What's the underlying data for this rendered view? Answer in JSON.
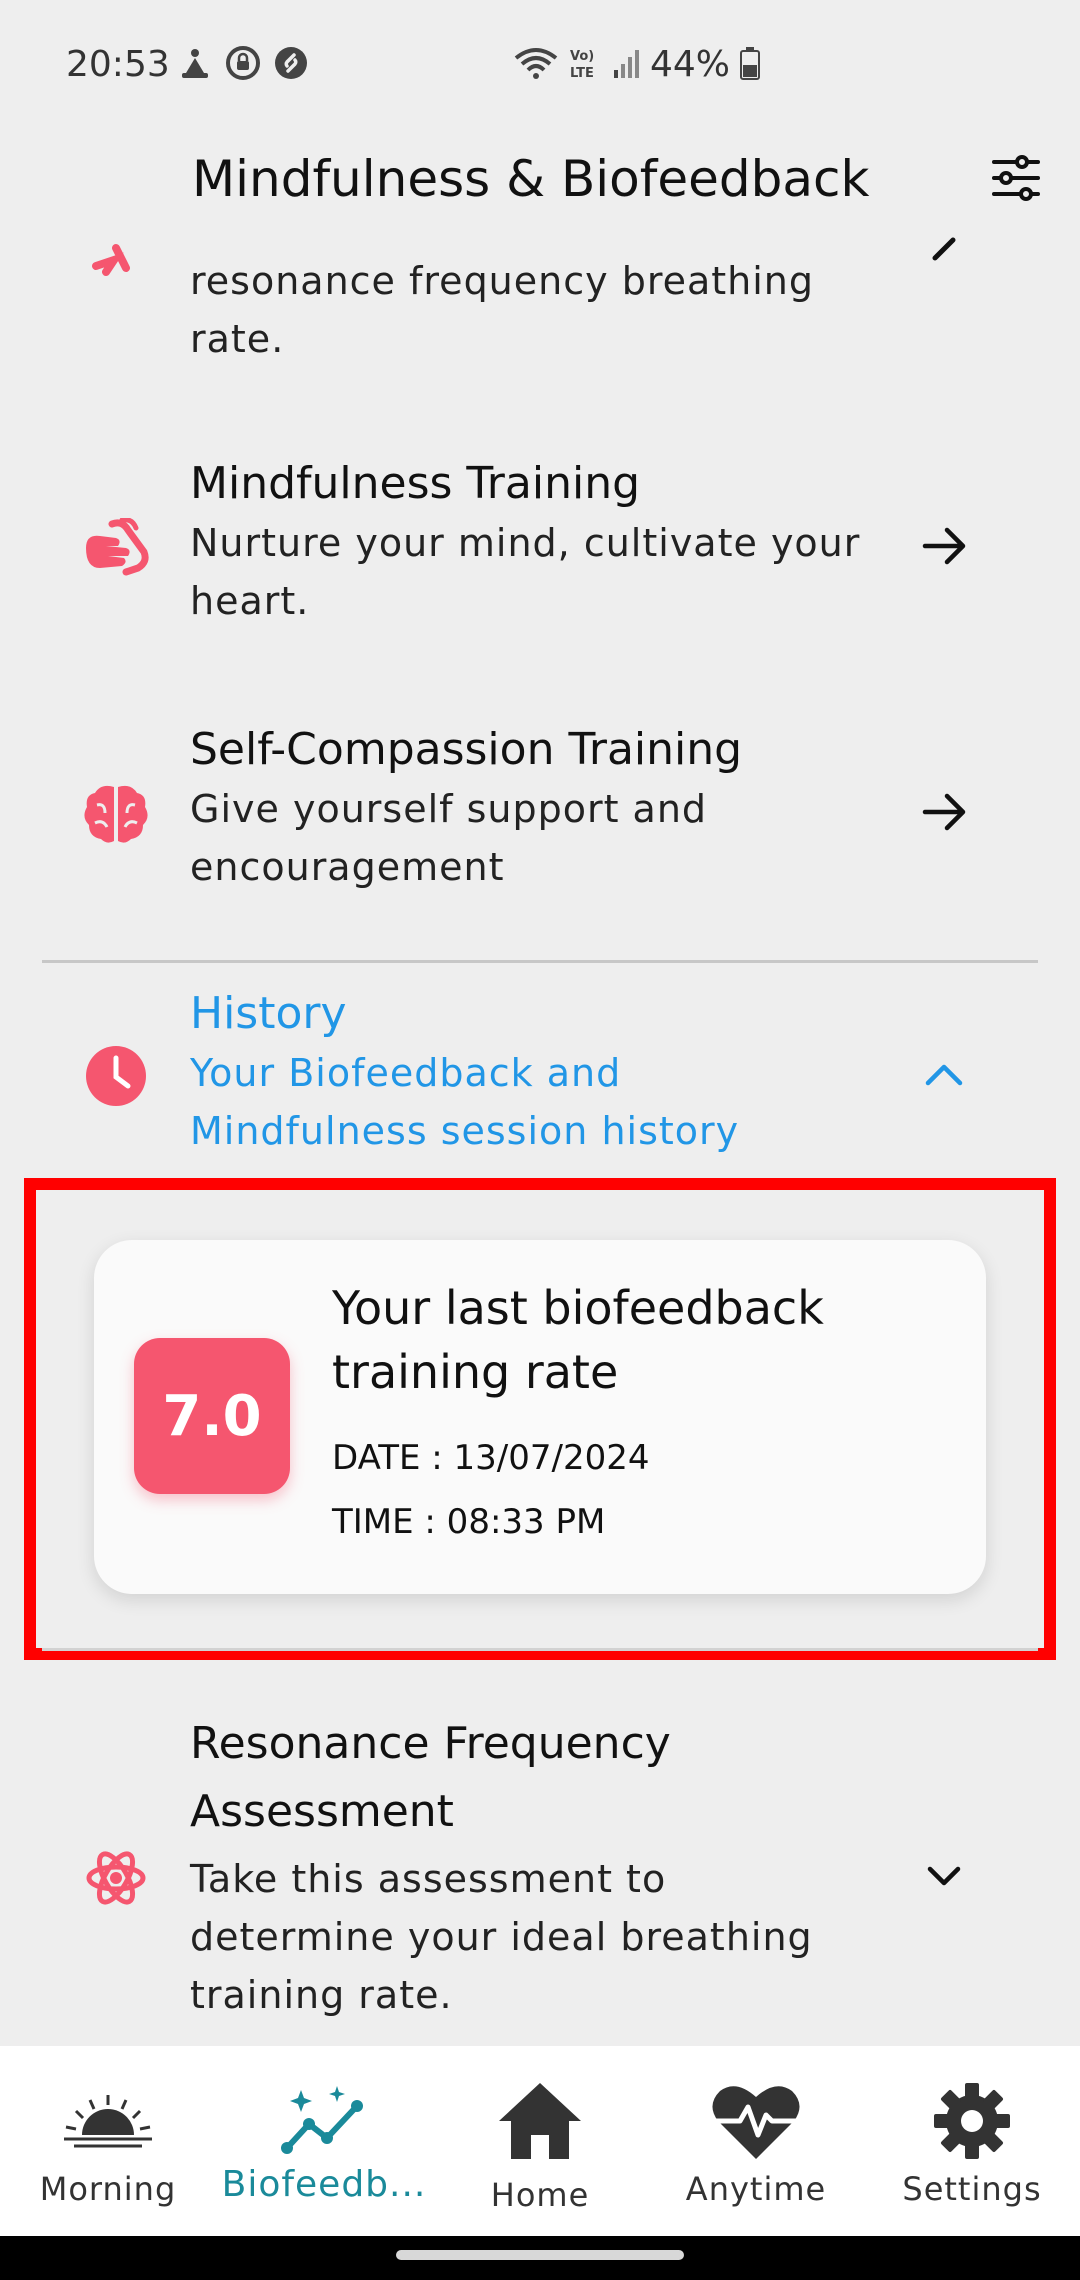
{
  "status_bar": {
    "time": "20:53",
    "battery": "44%"
  },
  "header": {
    "title": "Mindfulness & Biofeedback",
    "filter_icon": "sliders-icon"
  },
  "items": [
    {
      "key": "breathing",
      "desc": "resonance frequency breathing rate."
    },
    {
      "key": "mindfulness",
      "title": "Mindfulness Training",
      "desc": "Nurture your mind, cultivate your heart."
    },
    {
      "key": "self-compassion",
      "title": "Self-Compassion Training",
      "desc": "Give yourself support and encouragement"
    }
  ],
  "history": {
    "title": "History",
    "desc": "Your Biofeedback and Mindfulness session history"
  },
  "last_rate_card": {
    "rate": "7.0",
    "title": "Your last biofeedback training rate",
    "date_line": "DATE : 13/07/2024",
    "time_line": "TIME  : 08:33 PM"
  },
  "resonance": {
    "title": "Resonance Frequency Assessment",
    "desc": "Take this assessment to determine your ideal breathing training rate."
  },
  "bottom_nav": [
    {
      "label": "Morning",
      "icon": "sunrise-icon"
    },
    {
      "label": "Biofeedb...",
      "icon": "sparkle-chart-icon"
    },
    {
      "label": "Home",
      "icon": "home-icon"
    },
    {
      "label": "Anytime",
      "icon": "heartbeat-icon"
    },
    {
      "label": "Settings",
      "icon": "gear-icon"
    }
  ],
  "colors": {
    "accent_pink": "#f5566f",
    "accent_blue": "#2196e6",
    "nav_active": "#1a8a9a",
    "highlight_red": "#ff0000"
  }
}
